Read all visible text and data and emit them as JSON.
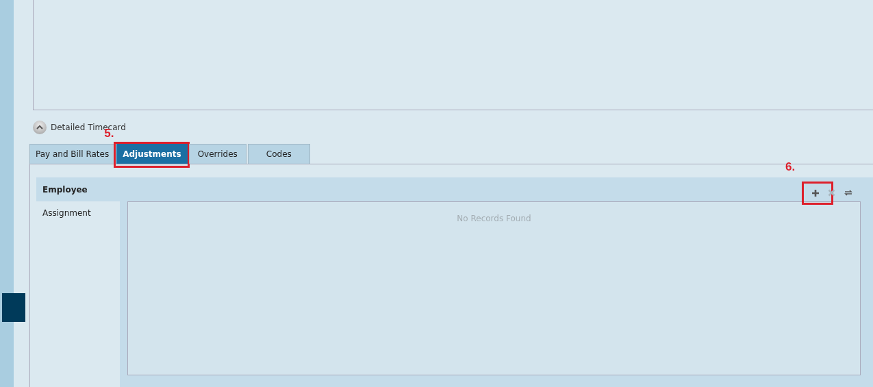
{
  "section": {
    "title": "Detailed Timecard",
    "expanded": true
  },
  "tabs": [
    {
      "label": "Pay and Bill Rates",
      "selected": false
    },
    {
      "label": "Adjustments",
      "selected": true,
      "callout": "5."
    },
    {
      "label": "Overrides",
      "selected": false
    },
    {
      "label": "Codes",
      "selected": false
    }
  ],
  "side_list": [
    {
      "label": "Employee",
      "selected": true
    },
    {
      "label": "Assignment",
      "selected": false
    }
  ],
  "toolbar": [
    {
      "kind": "add",
      "disabled": false,
      "callout": "6."
    },
    {
      "kind": "delete",
      "disabled": true
    },
    {
      "kind": "refresh",
      "disabled": false
    }
  ],
  "grid": {
    "empty_message": "No Records Found"
  }
}
